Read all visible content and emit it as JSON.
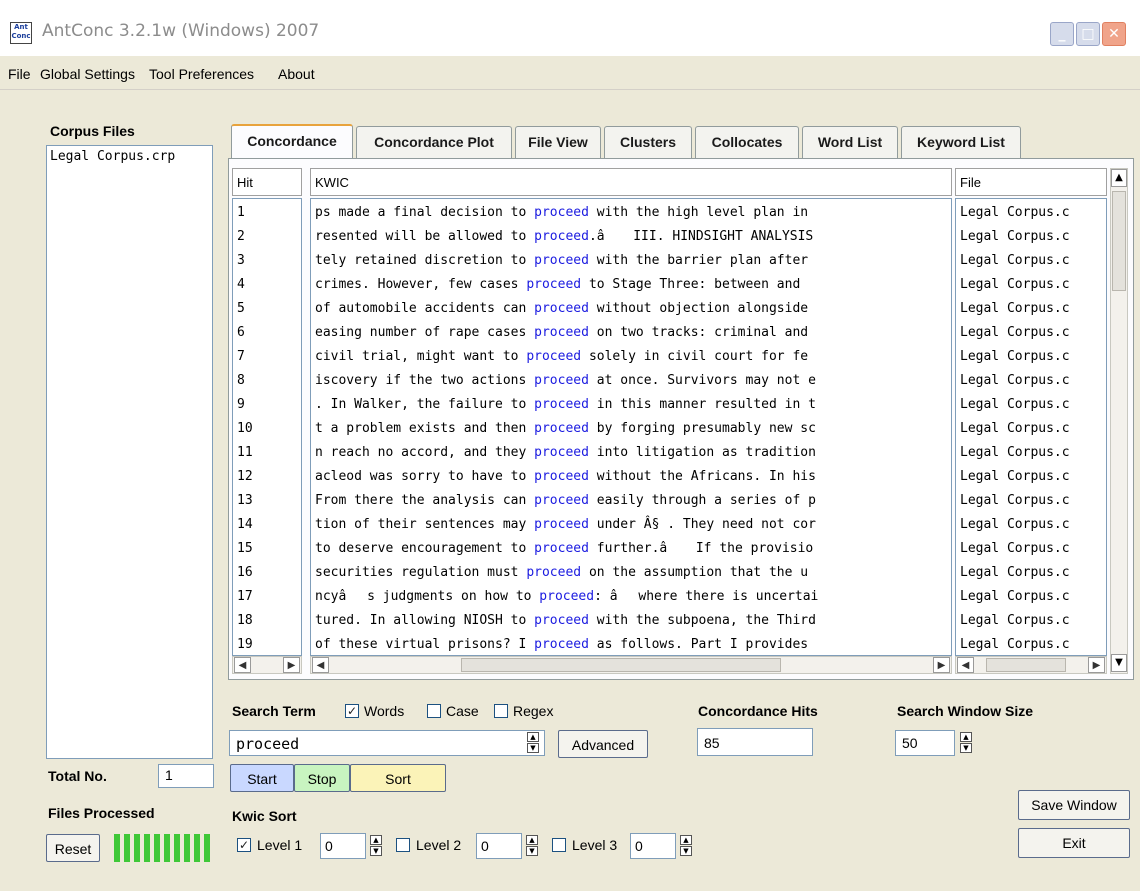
{
  "window": {
    "title": "AntConc 3.2.1w (Windows) 2007",
    "app_icon_text": "Ant Conc"
  },
  "menu": [
    "File",
    "Global Settings",
    "Tool Preferences",
    "About"
  ],
  "corpus": {
    "heading": "Corpus Files",
    "files": [
      "Legal Corpus.crp"
    ],
    "total_label": "Total No.",
    "total_value": "1",
    "processed_label": "Files Processed",
    "reset_label": "Reset"
  },
  "tabs": [
    "Concordance",
    "Concordance Plot",
    "File View",
    "Clusters",
    "Collocates",
    "Word List",
    "Keyword List"
  ],
  "columns": {
    "hit": "Hit",
    "kwic": "KWIC",
    "file": "File"
  },
  "keyword": "proceed",
  "rows": [
    {
      "hit": "1",
      "left": "ps made a final decision to ",
      "right": " with the high level plan in",
      "file": "Legal Corpus.c"
    },
    {
      "hit": "2",
      "left": "resented will be allowed to ",
      "right": ".â III. HINDSIGHT ANALYSIS",
      "file": "Legal Corpus.c"
    },
    {
      "hit": "3",
      "left": "tely retained discretion to ",
      "right": " with the barrier plan after",
      "file": "Legal Corpus.c"
    },
    {
      "hit": "4",
      "left": " crimes. However, few cases ",
      "right": " to Stage Three: between and",
      "file": "Legal Corpus.c"
    },
    {
      "hit": "5",
      "left": "of automobile accidents can ",
      "right": " without objection alongside",
      "file": "Legal Corpus.c"
    },
    {
      "hit": "6",
      "left": "easing number of rape cases ",
      "right": " on two tracks: criminal and",
      "file": "Legal Corpus.c"
    },
    {
      "hit": "7",
      "left": " civil trial, might want to ",
      "right": " solely in civil court for fe",
      "file": "Legal Corpus.c"
    },
    {
      "hit": "8",
      "left": "iscovery if the two actions ",
      "right": " at once. Survivors may not e",
      "file": "Legal Corpus.c"
    },
    {
      "hit": "9",
      "left": ". In Walker, the failure to ",
      "right": " in this manner resulted in t",
      "file": "Legal Corpus.c"
    },
    {
      "hit": "10",
      "left": "t a problem exists and then ",
      "right": " by forging presumably new sc",
      "file": "Legal Corpus.c"
    },
    {
      "hit": "11",
      "left": "n reach no accord, and they ",
      "right": " into litigation as tradition",
      "file": "Legal Corpus.c"
    },
    {
      "hit": "12",
      "left": "acleod was sorry to have to ",
      "right": " without the Africans. In his",
      "file": "Legal Corpus.c"
    },
    {
      "hit": "13",
      "left": "From there the analysis can ",
      "right": " easily through a series of p",
      "file": "Legal Corpus.c"
    },
    {
      "hit": "14",
      "left": "tion of their sentences may ",
      "right": " under Â§ . They need not cor",
      "file": "Legal Corpus.c"
    },
    {
      "hit": "15",
      "left": "to deserve encouragement to ",
      "right": " further.â If the provisio",
      "file": "Legal Corpus.c"
    },
    {
      "hit": "16",
      "left": " securities regulation must ",
      "right": " on the assumption that the u",
      "file": "Legal Corpus.c"
    },
    {
      "hit": "17",
      "left": "ncyâs judgments on how to ",
      "right": ": âwhere there is uncertai",
      "file": "Legal Corpus.c"
    },
    {
      "hit": "18",
      "left": "tured. In allowing NIOSH to ",
      "right": " with the subpoena, the Third",
      "file": "Legal Corpus.c"
    },
    {
      "hit": "19",
      "left": "of these virtual prisons? I ",
      "right": " as follows. Part I provides",
      "file": "Legal Corpus.c"
    }
  ],
  "search": {
    "label": "Search Term",
    "words_label": "Words",
    "words_checked": true,
    "case_label": "Case",
    "case_checked": false,
    "regex_label": "Regex",
    "regex_checked": false,
    "term": "proceed",
    "advanced_label": "Advanced",
    "start_label": "Start",
    "stop_label": "Stop",
    "sort_label": "Sort"
  },
  "hits": {
    "label": "Concordance Hits",
    "value": "85"
  },
  "window_size": {
    "label": "Search Window Size",
    "value": "50"
  },
  "kwic_sort": {
    "label": "Kwic Sort",
    "levels": [
      {
        "label": "Level 1",
        "checked": true,
        "value": "0"
      },
      {
        "label": "Level 2",
        "checked": false,
        "value": "0"
      },
      {
        "label": "Level 3",
        "checked": false,
        "value": "0"
      }
    ]
  },
  "actions": {
    "save_label": "Save Window",
    "exit_label": "Exit"
  },
  "colors": {
    "keyword": "#1b1be0",
    "start": "#c9d8ff",
    "stop": "#c8f4c0",
    "sort": "#fbf3b8",
    "progress": "#3fc837",
    "active_tab_accent": "#e8a33c"
  }
}
